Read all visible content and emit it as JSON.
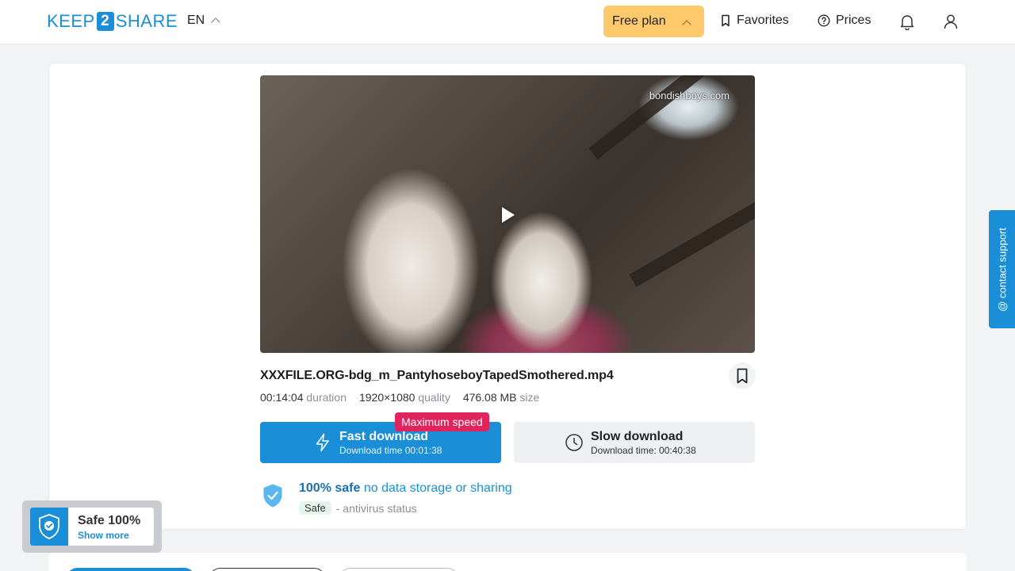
{
  "header": {
    "logo_left": "KEEP",
    "logo_num": "2",
    "logo_right": "SHARE",
    "language": "EN",
    "plan": "Free plan",
    "favorites": "Favorites",
    "prices": "Prices",
    "icons": [
      "bookmark-icon",
      "help-circle-icon",
      "bell-icon",
      "user-icon"
    ]
  },
  "video": {
    "watermark": "bondishboys.com"
  },
  "file": {
    "name": "XXXFILE.ORG-bdg_m_PantyhoseboyTapedSmothered.mp4",
    "duration": "00:14:04",
    "duration_label": "duration",
    "quality": "1920×1080",
    "quality_label": "quality",
    "size": "476.08 MB",
    "size_label": "size"
  },
  "download": {
    "badge": "Maximum speed",
    "fast_title": "Fast download",
    "fast_sub": "Download time 00:01:38",
    "slow_title": "Slow download",
    "slow_sub": "Download time: 00:40:38"
  },
  "safety": {
    "strong": "100% safe",
    "rest": "no data storage or sharing",
    "av_badge": "Safe",
    "av_text": "- antivirus status"
  },
  "support": {
    "label": "@ contact support"
  },
  "safe_widget": {
    "title": "Safe 100%",
    "link": "Show more"
  },
  "colors": {
    "brand": "#1a8fd8",
    "plan": "#fdc96a",
    "badge": "#e0245e"
  }
}
